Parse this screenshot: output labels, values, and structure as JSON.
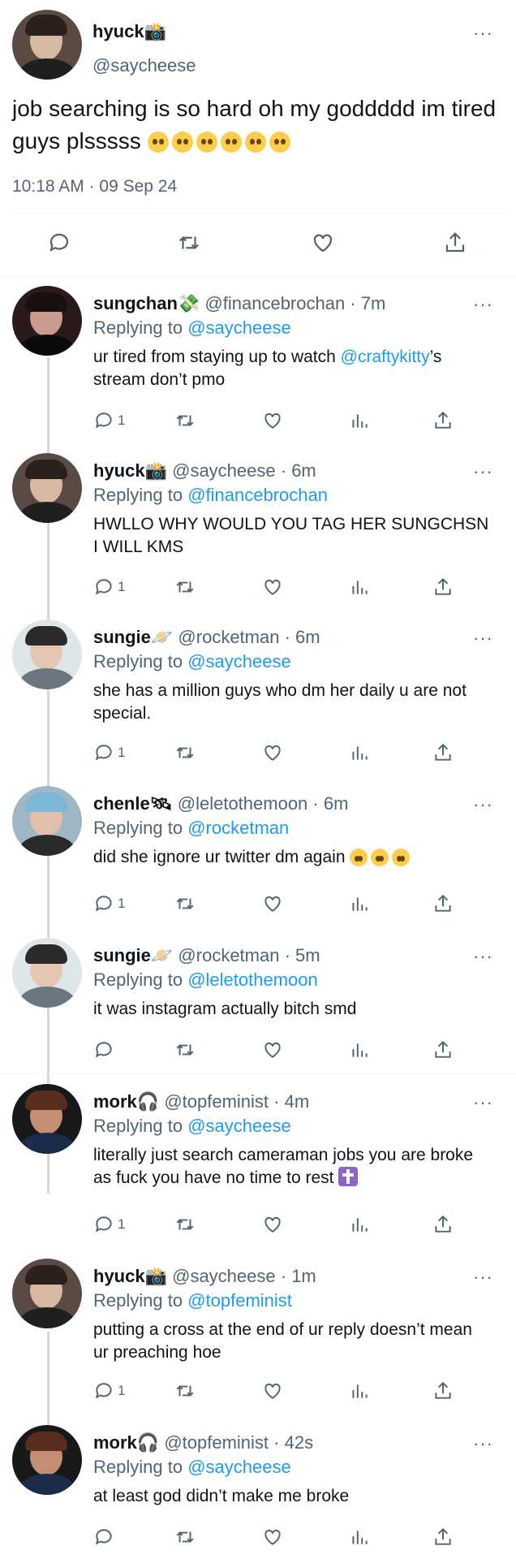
{
  "main_tweet": {
    "display_name": "hyuck📸",
    "handle": "@saycheese",
    "text": "job searching is so hard oh my goddddd im tired guys plsssss",
    "emoji_count": 6,
    "timestamp": "10:18 AM · 09 Sep 24",
    "more": "···"
  },
  "replies": [
    {
      "display_name": "sungchan💸",
      "handle": "@financebrochan",
      "time": "· 7m",
      "replying_label": "Replying to",
      "replying_to": "@saycheese",
      "text_parts": [
        "ur tired from staying up to watch ",
        "@craftykitty",
        "’s stream don’t pmo"
      ],
      "reply_count": "1",
      "more": "···"
    },
    {
      "display_name": "hyuck📸",
      "handle": "@saycheese",
      "time": "· 6m",
      "replying_label": "Replying to",
      "replying_to": "@financebrochan",
      "text": "HWLLO WHY WOULD YOU TAG HER SUNGCHSN I WILL KMS",
      "reply_count": "1",
      "more": "···"
    },
    {
      "display_name": "sungie🪐",
      "handle": "@rocketman",
      "time": "· 6m",
      "replying_label": "Replying to",
      "replying_to": "@saycheese",
      "text": "she has a million guys who dm her daily u are not special.",
      "reply_count": "1",
      "more": "···"
    },
    {
      "display_name": "chenle🛰",
      "handle": "@leletothemoon",
      "time": "· 6m",
      "replying_label": "Replying to",
      "replying_to": "@rocketman",
      "text": "did she ignore ur twitter dm again",
      "emoji_count": 3,
      "reply_count": "1",
      "more": "···"
    },
    {
      "display_name": "sungie🪐",
      "handle": "@rocketman",
      "time": "· 5m",
      "replying_label": "Replying to",
      "replying_to": "@leletothemoon",
      "text": "it was instagram actually bitch smd",
      "reply_count": "",
      "more": "···"
    },
    {
      "display_name": "mork🎧",
      "handle": "@topfeminist",
      "time": "· 4m",
      "replying_label": "Replying to",
      "replying_to": "@saycheese",
      "text": "literally just search cameraman jobs you are broke as fuck you have no time to rest",
      "reply_count": "1",
      "more": "···"
    },
    {
      "display_name": "hyuck📸",
      "handle": "@saycheese",
      "time": "· 1m",
      "replying_label": "Replying to",
      "replying_to": "@topfeminist",
      "text": "putting a cross at the end of ur reply doesn’t mean ur preaching hoe",
      "reply_count": "1",
      "more": "···"
    },
    {
      "display_name": "mork🎧",
      "handle": "@topfeminist",
      "time": "· 42s",
      "replying_label": "Replying to",
      "replying_to": "@saycheese",
      "text": "at least god didn’t make me broke",
      "reply_count": "",
      "more": "···"
    }
  ],
  "colors": {
    "link": "#1d9bf0",
    "muted": "#536471",
    "divider": "#eff3f4",
    "thread": "#cfd9de"
  },
  "icons": [
    "reply-icon",
    "retweet-icon",
    "like-icon",
    "views-icon",
    "share-icon",
    "more-icon"
  ]
}
